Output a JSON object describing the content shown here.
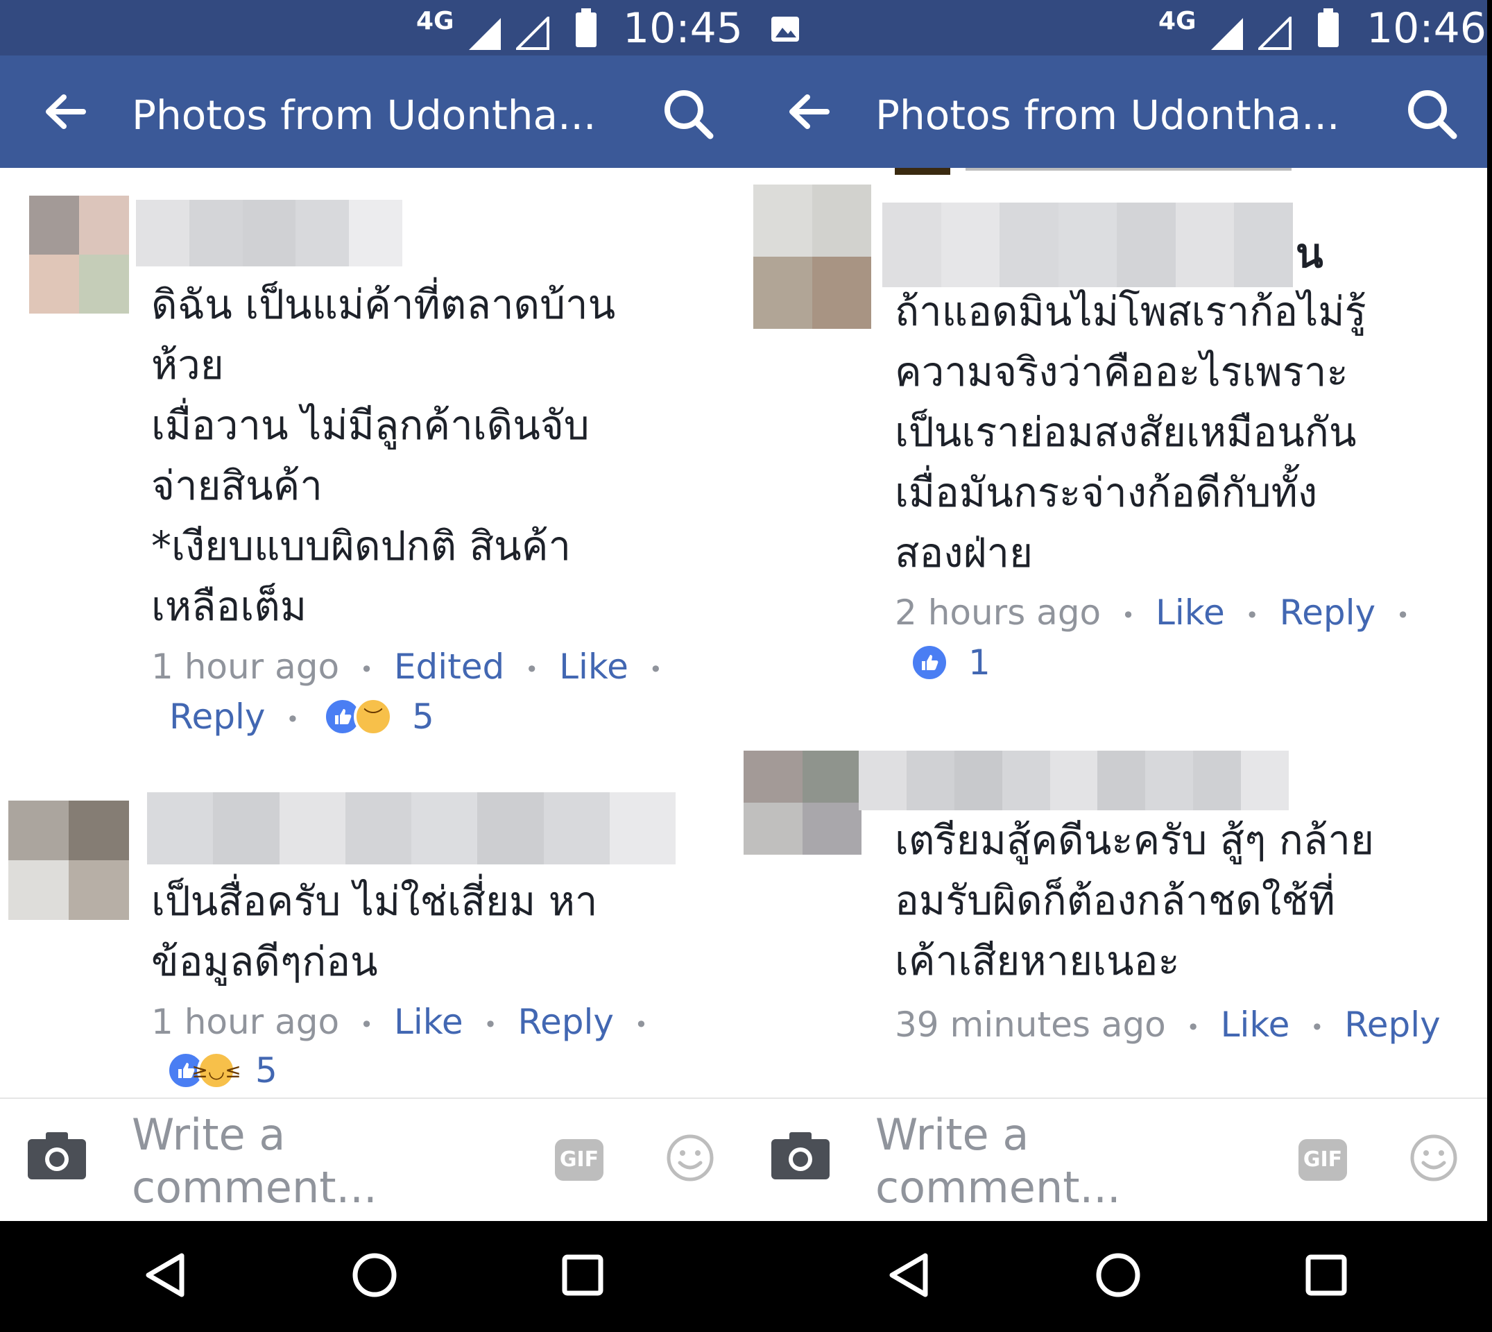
{
  "screens": [
    {
      "status": {
        "network": "4G",
        "time": "10:45"
      },
      "appbar": {
        "title": "Photos from Udontha..."
      },
      "comments": [
        {
          "lines": [
            "ดิฉัน เป็นแม่ค้าที่ตลาดบ้าน",
            "ห้วย",
            "เมื่อวาน ไม่มีลูกค้าเดินจับ",
            "จ่ายสินค้า",
            "*เงียบแบบผิดปกติ สินค้า",
            "เหลือเต็ม"
          ],
          "time": "1 hour ago",
          "edited": "Edited",
          "like": "Like",
          "reply": "Reply",
          "reaction_count": "5",
          "reactions": [
            "like-icon",
            "sad-icon"
          ]
        },
        {
          "lines": [
            "เป็นสื่อครับ ไม่ใช่เสี่ยม หา",
            "ข้อมูลดีๆก่อน"
          ],
          "time": "1 hour ago",
          "like": "Like",
          "reply": "Reply",
          "reaction_count": "5",
          "reactions": [
            "like-icon",
            "haha-icon"
          ]
        }
      ],
      "composer": {
        "placeholder_line1": "Write a",
        "placeholder_line2": "comment...",
        "gif": "GIF"
      }
    },
    {
      "status": {
        "network": "4G",
        "time": "10:46"
      },
      "appbar": {
        "title": "Photos from Udontha..."
      },
      "comments": [
        {
          "lines": [
            "ถ้าแอดมินไม่โพสเราก้อไม่รู้",
            "ความจริงว่าคืออะไรเพราะ",
            "เป็นเราย่อมสงสัยเหมือนกัน",
            "เมื่อมันกระจ่างก้อดีกับทั้ง",
            "สองฝ่าย"
          ],
          "name_tail": "น",
          "time": "2 hours ago",
          "like": "Like",
          "reply": "Reply",
          "reaction_count": "1",
          "reactions": [
            "like-icon"
          ]
        },
        {
          "lines": [
            "เตรียมสู้คดีนะครับ  สู้ๆ กล้าย",
            "อมรับผิดก็ต้องกล้าชดใช้ที่",
            "เค้าเสียหายเนอะ"
          ],
          "time": "39 minutes ago",
          "like": "Like",
          "reply": "Reply"
        }
      ],
      "composer": {
        "placeholder_line1": "Write a",
        "placeholder_line2": "comment...",
        "gif": "GIF"
      }
    }
  ],
  "navbar": {
    "icons": [
      "back-nav-icon",
      "home-nav-icon",
      "recents-nav-icon"
    ]
  },
  "colors": {
    "appbar": "#3b5998",
    "statusbar": "#334a80",
    "link": "#4267b2",
    "meta": "#90949c"
  }
}
